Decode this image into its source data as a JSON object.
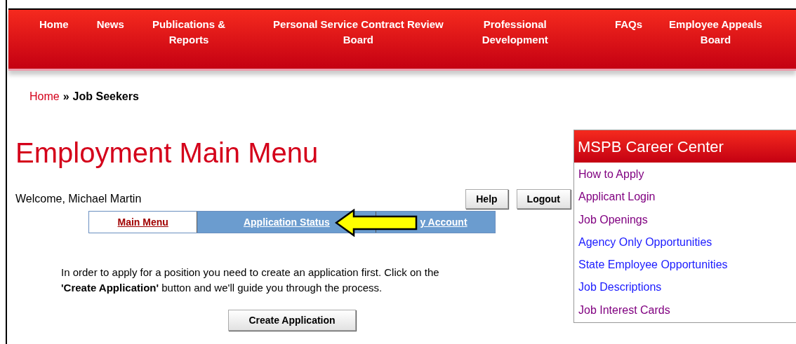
{
  "nav": [
    "Home",
    "News",
    "Publications &\nReports",
    "Personal Service Contract Review\nBoard",
    "Professional\nDevelopment",
    "FAQs",
    "Employee Appeals\nBoard"
  ],
  "breadcrumb": {
    "link": "Home",
    "separator": "»",
    "current": "Job Seekers"
  },
  "title": "Employment Main Menu",
  "welcome": "Welcome, Michael Martin",
  "buttons": [
    "Help",
    "Logout"
  ],
  "tabs": [
    {
      "label": "Main Menu",
      "selected": true
    },
    {
      "label": "Application Status",
      "selected": false
    },
    {
      "label": "y Account",
      "selected": false
    }
  ],
  "message": "In order to apply for a position you need to create an application first. Click on the **'Create Application'** button and we'll guide you through the process.",
  "create_button": "Create Application",
  "sidebar": {
    "title": "MSPB Career Center",
    "links": [
      {
        "label": "How to Apply",
        "visited": true
      },
      {
        "label": "Applicant Login",
        "visited": true
      },
      {
        "label": "Job Openings",
        "visited": true
      },
      {
        "label": "Agency Only Opportunities",
        "visited": false
      },
      {
        "label": "State Employee Opportunities",
        "visited": false
      },
      {
        "label": "Job Descriptions",
        "visited": false
      },
      {
        "label": "Job Interest Cards",
        "visited": true
      }
    ]
  }
}
